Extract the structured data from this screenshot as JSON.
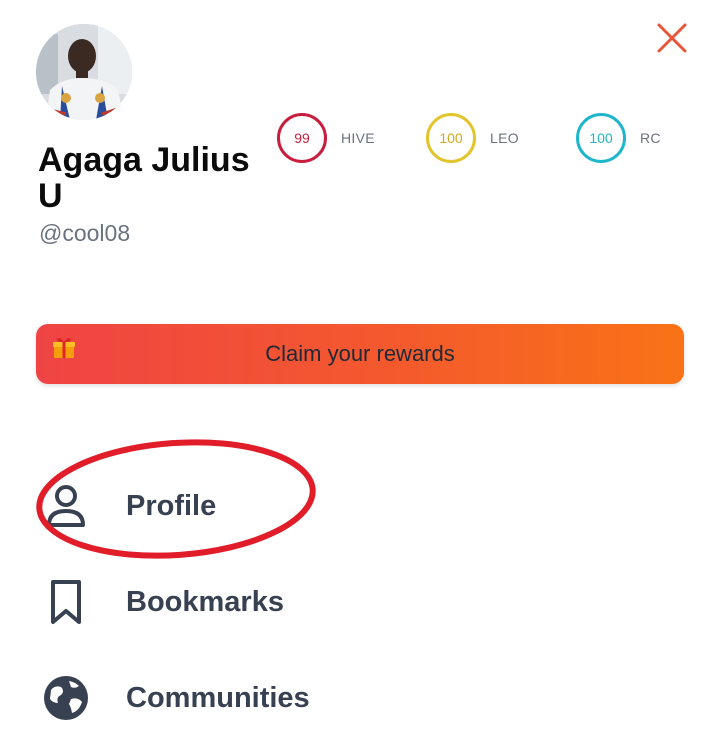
{
  "header": {
    "close_icon": "close-icon",
    "close_color": "#e8553a"
  },
  "user": {
    "display_name": "Agaga Julius U",
    "handle": "@cool08"
  },
  "balances": [
    {
      "value": "99",
      "label": "HIVE",
      "color": "#c81e3e"
    },
    {
      "value": "100",
      "label": "LEO",
      "color": "#e2c42b"
    },
    {
      "value": "100",
      "label": "RC",
      "color": "#1fb6cc"
    }
  ],
  "rewards": {
    "label": "Claim your rewards",
    "icon": "gift-icon"
  },
  "menu": {
    "items": [
      {
        "label": "Profile",
        "icon": "user-icon"
      },
      {
        "label": "Bookmarks",
        "icon": "bookmark-icon"
      },
      {
        "label": "Communities",
        "icon": "globe-icon"
      }
    ]
  }
}
